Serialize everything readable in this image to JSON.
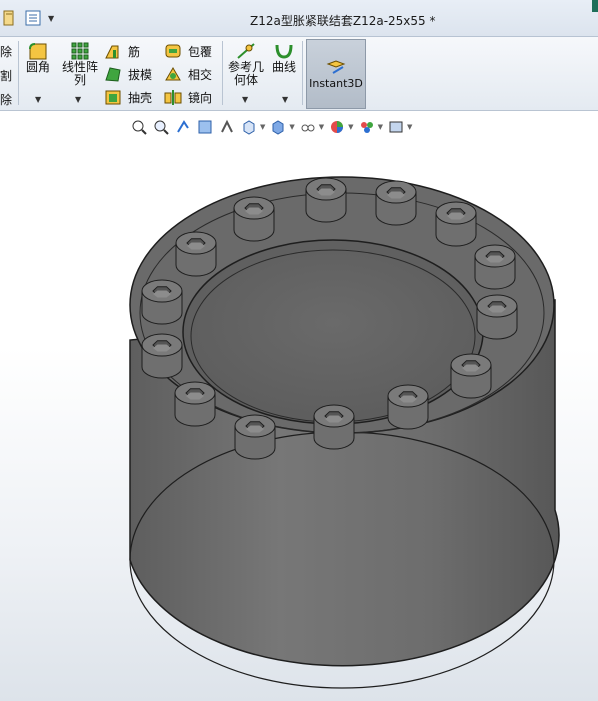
{
  "window": {
    "title": "Z12a型胀紧联结套Z12a-25x55 *"
  },
  "ribbon": {
    "left_partial": [
      "除",
      "割",
      "除"
    ],
    "fillet_label": "圆角",
    "linear_pattern_label": "线性阵列",
    "rib_label": "筋",
    "draft_label": "拔模",
    "shell_label": "抽壳",
    "wrap_label": "包覆",
    "intersect_label": "相交",
    "mirror_label": "镜向",
    "ref_geometry_label": "参考几何体",
    "curves_label": "曲线",
    "instant3d_label": "Instant3D"
  },
  "colors": {
    "accent": "#1f6f5a",
    "part_gray": "#6e6e6e",
    "instant3d_bg": "#b9c3cf"
  },
  "heads_up_toolbar": [
    "zoom-to-fit-icon",
    "zoom-to-area-icon",
    "previous-view-icon",
    "section-view-icon",
    "dynamic-annotation-icon",
    "view-orientation-icon",
    "display-style-icon",
    "hide-show-icon",
    "edit-appearance-icon",
    "apply-scene-icon",
    "view-settings-icon"
  ]
}
